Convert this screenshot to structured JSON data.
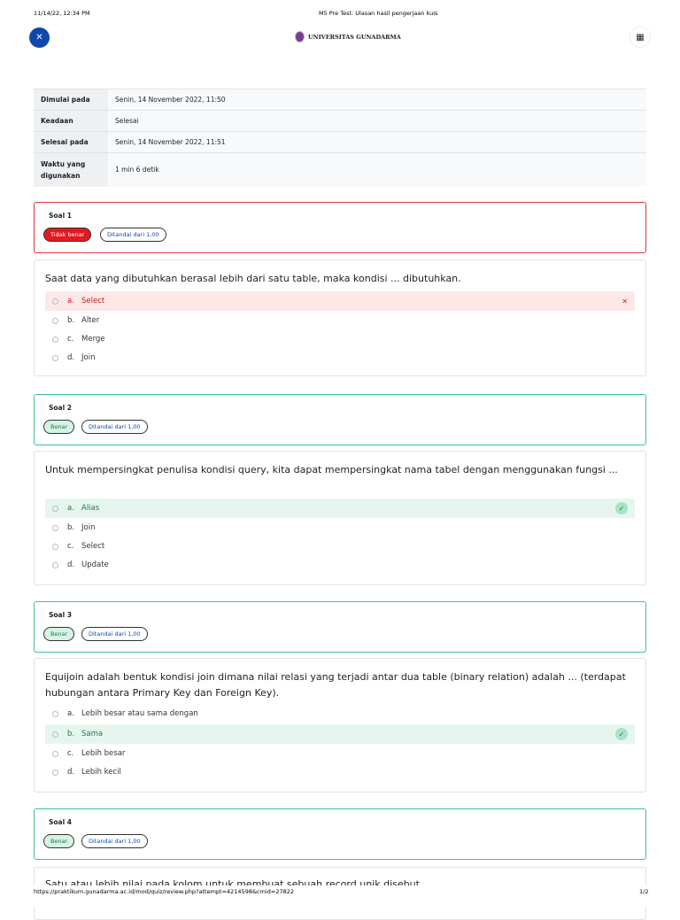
{
  "print_header": {
    "datetime": "11/14/22, 12:34 PM",
    "title": "M5 Pre Test: Ulasan hasil pengerjaan kuis"
  },
  "header": {
    "logo_text": "UNIVERSITAS GUNADARMA",
    "close_icon": "close-icon",
    "menu_icon": "grid-icon"
  },
  "summary": [
    {
      "label": "Dimulai pada",
      "value": "Senin, 14 November 2022, 11:50"
    },
    {
      "label": "Keadaan",
      "value": "Selesai"
    },
    {
      "label": "Selesai pada",
      "value": "Senin, 14 November 2022, 11:51"
    },
    {
      "label": "Waktu yang digunakan",
      "value": "1 min 6 detik"
    }
  ],
  "questions": [
    {
      "title": "Soal 1",
      "status": "Tidak benar",
      "mark": "Ditandai dari 1,00",
      "text": "Saat data yang dibutuhkan berasal lebih dari satu table, maka kondisi ... dibutuhkan.",
      "options": [
        {
          "key": "a.",
          "label": "Select"
        },
        {
          "key": "b.",
          "label": "Alter"
        },
        {
          "key": "c.",
          "label": "Merge"
        },
        {
          "key": "d.",
          "label": "Join"
        }
      ]
    },
    {
      "title": "Soal 2",
      "status": "Benar",
      "mark": "Ditandai dari 1,00",
      "text": "Untuk mempersingkat penulisa kondisi query, kita dapat mempersingkat nama tabel dengan menggunakan fungsi ...",
      "options": [
        {
          "key": "a.",
          "label": "Alias"
        },
        {
          "key": "b.",
          "label": "Join"
        },
        {
          "key": "c.",
          "label": "Select"
        },
        {
          "key": "d.",
          "label": "Update"
        }
      ]
    },
    {
      "title": "Soal 3",
      "status": "Benar",
      "mark": "Ditandai dari 1,00",
      "text": "Equijoin adalah bentuk kondisi join dimana nilai relasi yang terjadi antar dua table (binary relation) adalah ... (terdapat hubungan antara Primary Key dan Foreign Key).",
      "options": [
        {
          "key": "a.",
          "label": "Lebih besar atau sama dengan"
        },
        {
          "key": "b.",
          "label": "Sama"
        },
        {
          "key": "c.",
          "label": "Lebih besar"
        },
        {
          "key": "d.",
          "label": "Lebih kecil"
        }
      ]
    },
    {
      "title": "Soal 4",
      "status": "Benar",
      "mark": "Ditandai dari 1,00",
      "text": "Satu atau lebih nilai pada kolom untuk membuat sebuah record unik disebut"
    }
  ],
  "print_footer": {
    "url": "https://praktikum.gunadarma.ac.id/mod/quiz/review.php?attempt=4214598&cmid=27822",
    "page": "1/2"
  }
}
